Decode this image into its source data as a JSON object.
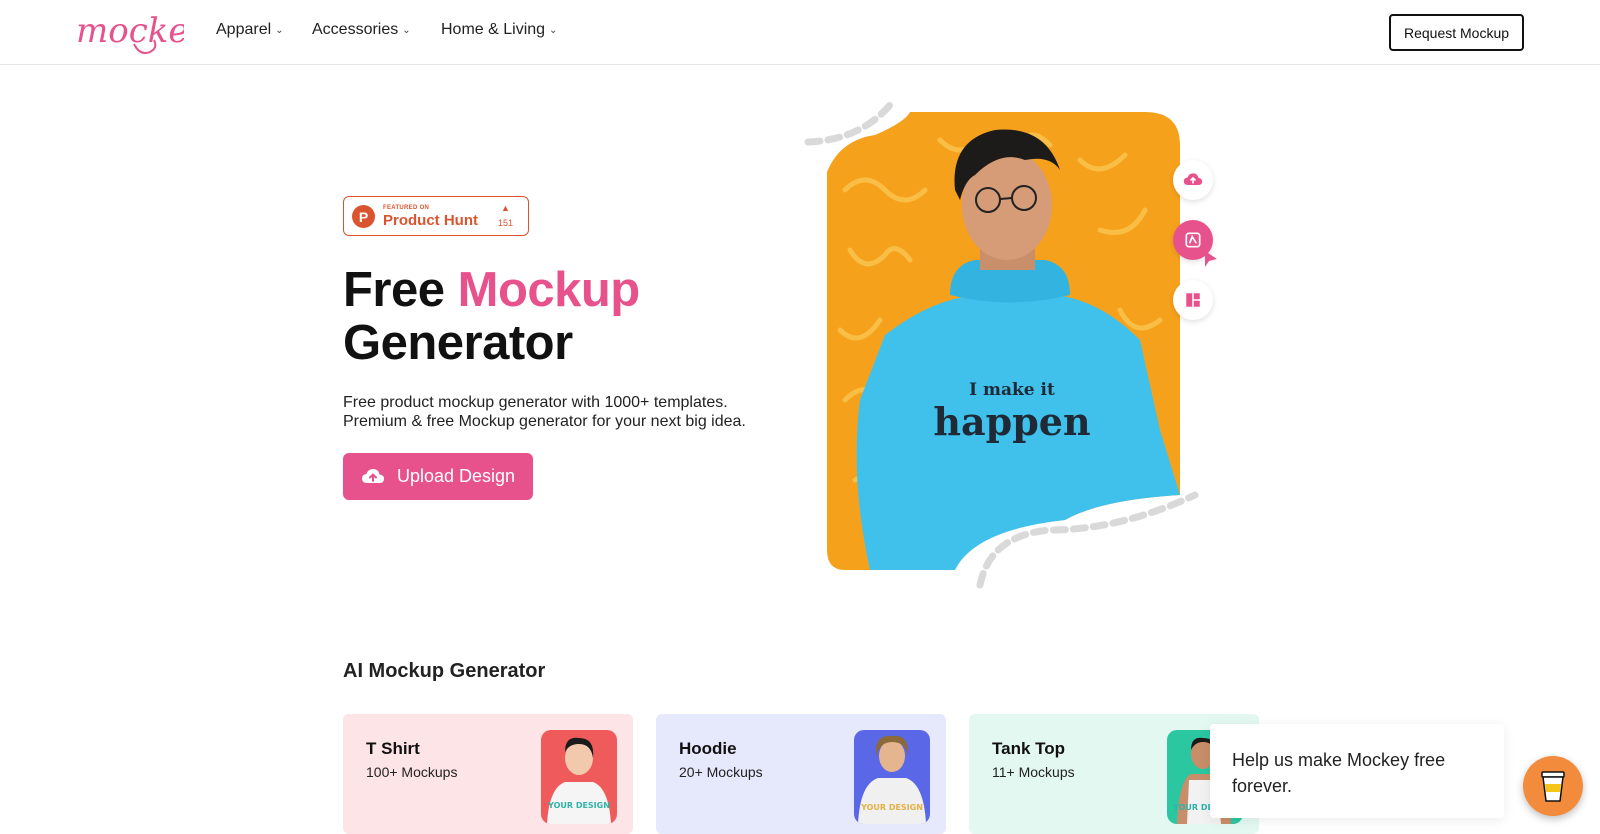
{
  "header": {
    "logo_text": "mockey",
    "nav": [
      {
        "label": "Apparel"
      },
      {
        "label": "Accessories"
      },
      {
        "label": "Home & Living"
      }
    ],
    "request_button": "Request Mockup"
  },
  "product_hunt": {
    "small": "FEATURED ON",
    "main": "Product Hunt",
    "count": "151",
    "letter": "P"
  },
  "hero": {
    "title_part1": "Free ",
    "title_highlight": "Mockup",
    "title_part2": "Generator",
    "description_line1": "Free product mockup generator with 1000+ templates.",
    "description_line2": "Premium & free Mockup generator for your next big idea.",
    "upload_button": "Upload Design",
    "shirt_text_top": "I make it",
    "shirt_text_bottom": "happen"
  },
  "section": {
    "title": "AI Mockup Generator"
  },
  "cards": [
    {
      "title": "T Shirt",
      "subtitle": "100+ Mockups",
      "img_text": "YOUR DESIGN"
    },
    {
      "title": "Hoodie",
      "subtitle": "20+ Mockups",
      "img_text": "YOUR DESIGN"
    },
    {
      "title": "Tank Top",
      "subtitle": "11+ Mockups",
      "img_text": "YOUR DESIGN"
    }
  ],
  "toast": {
    "text": "Help us make Mockey free forever."
  },
  "colors": {
    "brand_pink": "#e7528d",
    "product_hunt": "#da552f",
    "hero_bg_orange": "#f6a11c",
    "sweater_blue": "#3fc1ec",
    "bmc_orange": "#f28c3c"
  }
}
